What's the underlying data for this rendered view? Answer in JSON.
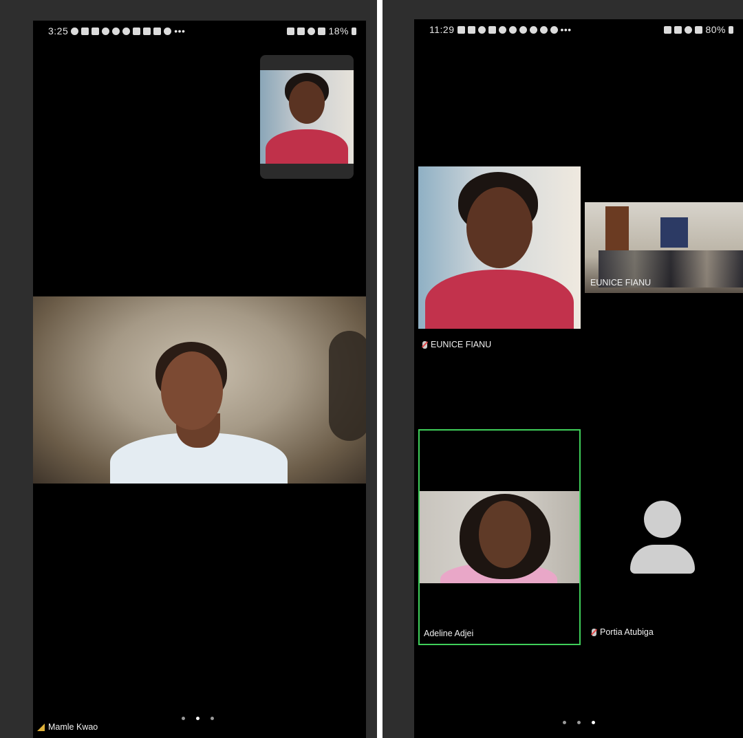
{
  "left_screen": {
    "status": {
      "time": "3:25",
      "overflow": "•••",
      "battery": "18%"
    },
    "active_speaker": {
      "name": "Mamle Kwao"
    },
    "page_indicator": {
      "count": 3,
      "active": 2
    }
  },
  "right_screen": {
    "status": {
      "time": "11:29",
      "overflow": "•••",
      "battery": "80%"
    },
    "participants": [
      {
        "name": "EUNICE FIANU"
      },
      {
        "name": "EUNICE FIANU"
      },
      {
        "name": "Adeline Adjei"
      },
      {
        "name": "Portia Atubiga"
      }
    ],
    "page_indicator": {
      "count": 3,
      "active": 3
    }
  },
  "colors": {
    "active_speaker_border": "#3fcf5a",
    "background": "#000000"
  }
}
